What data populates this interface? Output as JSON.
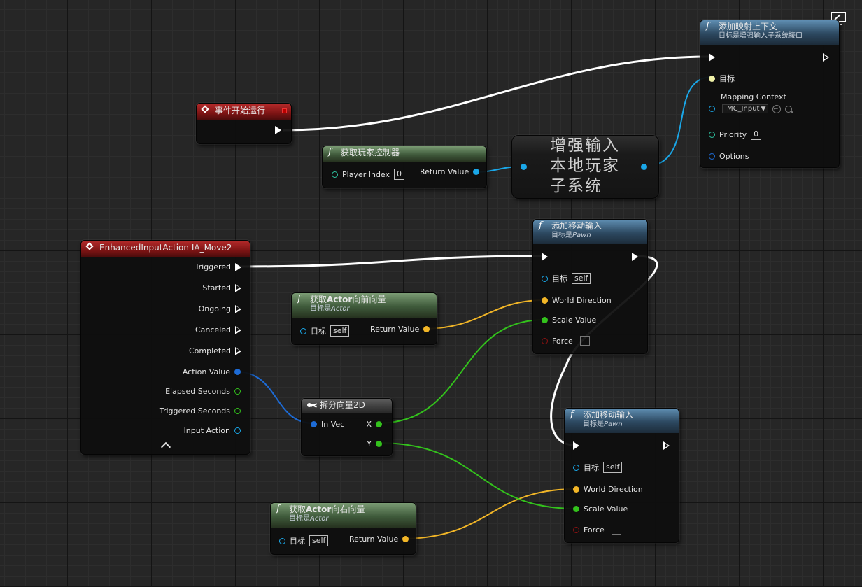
{
  "nodes": {
    "begin_play": {
      "title": "事件开始运行"
    },
    "get_player_controller": {
      "title": "获取玩家控制器",
      "player_index_label": "Player Index",
      "player_index_value": "0",
      "return_label": "Return Value"
    },
    "subsystem": {
      "line1": "增强输入",
      "line2": "本地玩家",
      "line3": "子系统"
    },
    "add_mapping_context": {
      "title": "添加映射上下文",
      "subtitle": "目标是增强输入子系统接口",
      "target_label": "目标",
      "mapping_context_label": "Mapping Context",
      "mapping_context_value": "IMC_Input",
      "priority_label": "Priority",
      "priority_value": "0",
      "options_label": "Options"
    },
    "input_action": {
      "title": "EnhancedInputAction IA_Move2",
      "outputs": [
        "Triggered",
        "Started",
        "Ongoing",
        "Canceled",
        "Completed",
        "Action Value",
        "Elapsed Seconds",
        "Triggered Seconds",
        "Input Action"
      ]
    },
    "get_forward": {
      "title_pre": "获取",
      "title_bold": "Actor",
      "title_post": "向前向量",
      "subtitle_pre": "目标是",
      "subtitle_italic": "Actor",
      "target_label": "目标",
      "target_value": "self",
      "return_label": "Return Value"
    },
    "get_right": {
      "title_pre": "获取",
      "title_bold": "Actor",
      "title_post": "向右向量",
      "subtitle_pre": "目标是",
      "subtitle_italic": "Actor",
      "target_label": "目标",
      "target_value": "self",
      "return_label": "Return Value"
    },
    "break_vector": {
      "title": "拆分向量2D",
      "in_label": "In Vec",
      "x_label": "X",
      "y_label": "Y"
    },
    "add_movement_1": {
      "title": "添加移动输入",
      "subtitle_pre": "目标是",
      "subtitle_italic": "Pawn",
      "target_label": "目标",
      "target_value": "self",
      "world_direction": "World Direction",
      "scale_value": "Scale Value",
      "force": "Force"
    },
    "add_movement_2": {
      "title": "添加移动输入",
      "subtitle_pre": "目标是",
      "subtitle_italic": "Pawn",
      "target_label": "目标",
      "target_value": "self",
      "world_direction": "World Direction",
      "scale_value": "Scale Value",
      "force": "Force"
    }
  },
  "colors": {
    "exec": "#ffffff",
    "object": "#1aa7e8",
    "vector": "#f2b627",
    "float": "#33c21c",
    "bool": "#8c1212",
    "vector2d": "#1d6bd6",
    "struct": "#2ec4a0",
    "self": "#f0f2a8"
  }
}
